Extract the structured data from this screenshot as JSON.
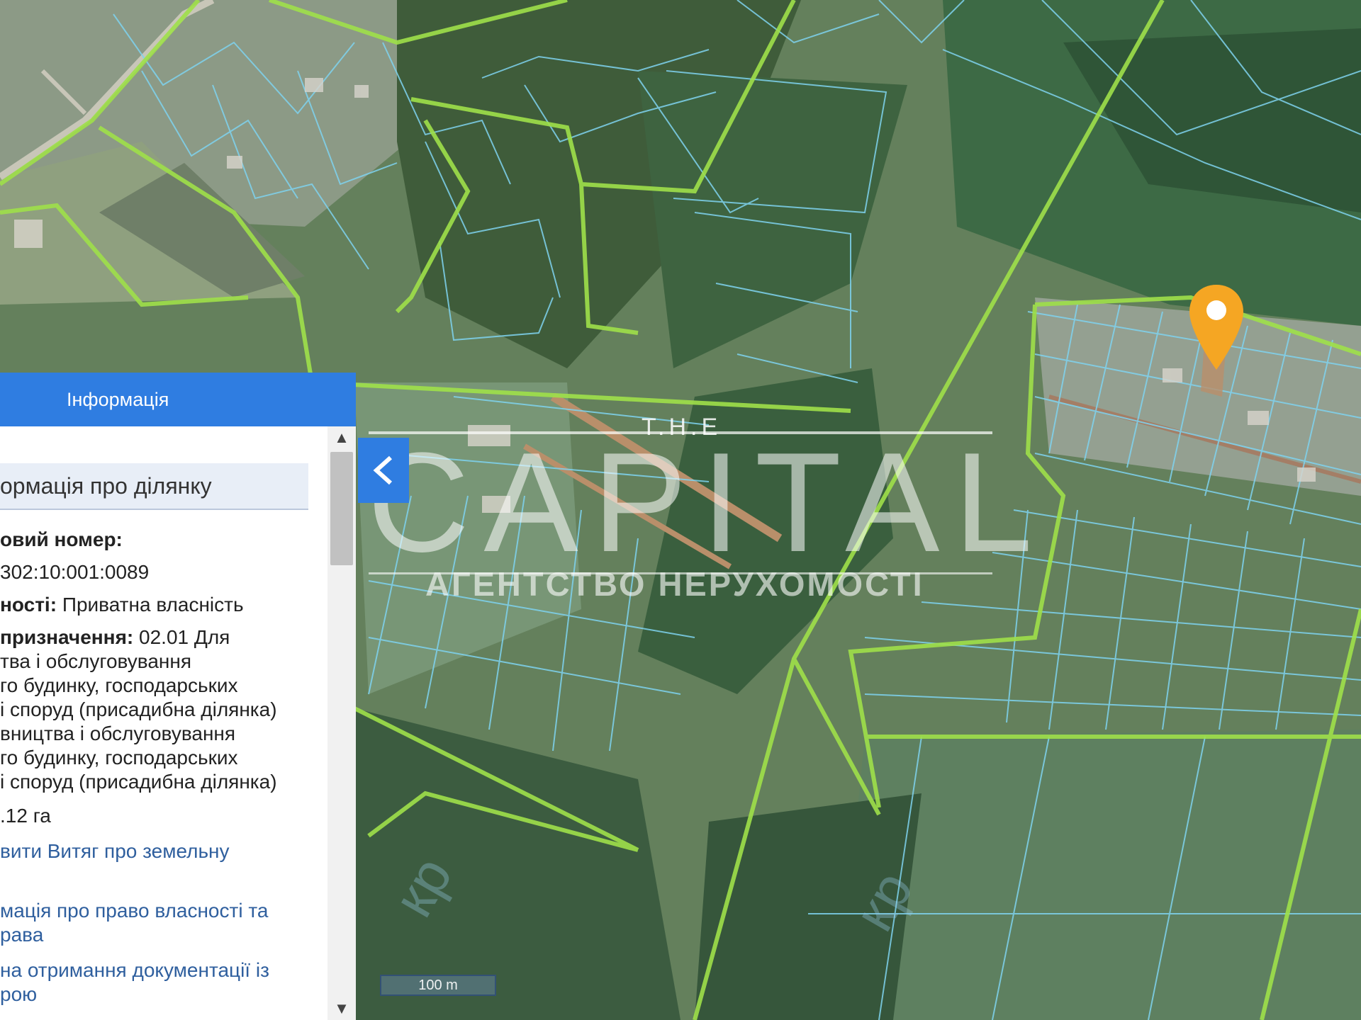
{
  "panel": {
    "header_title": "Інформація",
    "section_title": "ормація про ділянку",
    "cadastral_label": "овий номер:",
    "cadastral_value": "302:10:001:0089",
    "ownership_label": "ності:",
    "ownership_value": "Приватна власність",
    "purpose_label": "призначення:",
    "purpose_value": "02.01 Для",
    "purpose_lines": [
      "тва і обслуговування",
      "го будинку, господарських",
      "і споруд (присадибна ділянка)",
      "вництва і обслуговування",
      "го будинку, господарських",
      "і споруд (присадибна ділянка)"
    ],
    "area_value": ".12 га",
    "links": [
      "вити Витяг про земельну",
      "мація про право власності та",
      "рава",
      "на отримання документації із",
      "рою"
    ]
  },
  "watermark": {
    "the": "T.H.E",
    "capital": "CAPITAL",
    "agency": "АГЕНТСТВО НЕРУХОМОСТІ"
  },
  "map": {
    "scale_label": "100 m",
    "pin_color": "#f5a623",
    "parcel_line_color": "#7fd3ef",
    "boundary_line_color": "#9fe04a"
  }
}
